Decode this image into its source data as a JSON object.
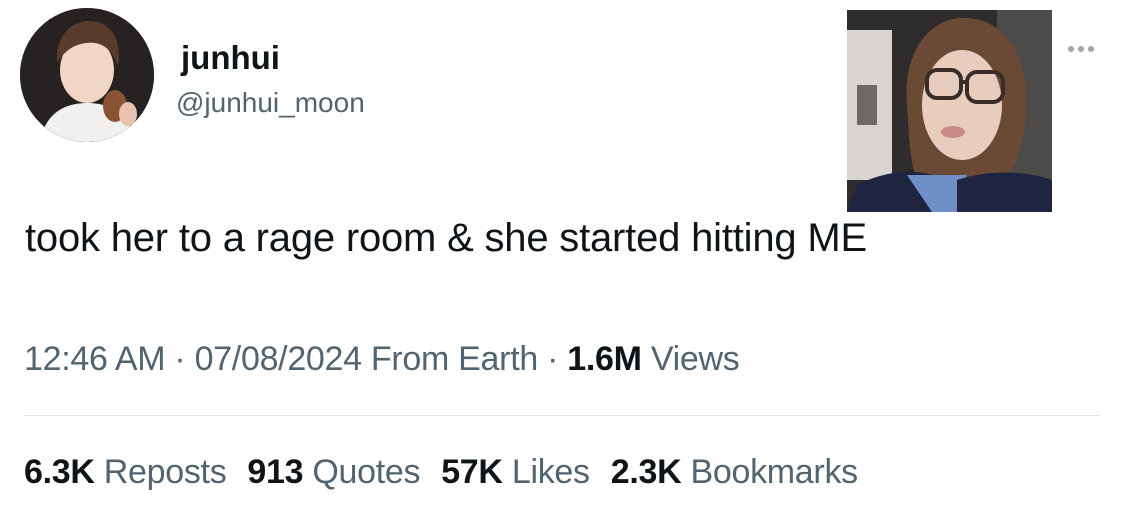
{
  "author": {
    "display_name": "junhui",
    "handle": "@junhui_moon",
    "avatar_icon": "profile-photo"
  },
  "tweet": {
    "text": "took her to a rage room & she started hitting ME",
    "media_icon": "attached-selfie-photo",
    "more_icon": "more-options-icon"
  },
  "meta": {
    "time": "12:46 AM",
    "sep1": " · ",
    "date": "07/08/2024",
    "source": " From Earth",
    "sep2": " · ",
    "views_count": "1.6M",
    "views_label": " Views"
  },
  "stats": {
    "reposts_count": "6.3K",
    "reposts_label": " Reposts",
    "quotes_count": "913",
    "quotes_label": " Quotes",
    "likes_count": "57K",
    "likes_label": " Likes",
    "bookmarks_count": "2.3K",
    "bookmarks_label": " Bookmarks"
  },
  "colors": {
    "text_primary": "#0f1419",
    "text_secondary": "#536471",
    "divider": "#e1e6ea"
  }
}
